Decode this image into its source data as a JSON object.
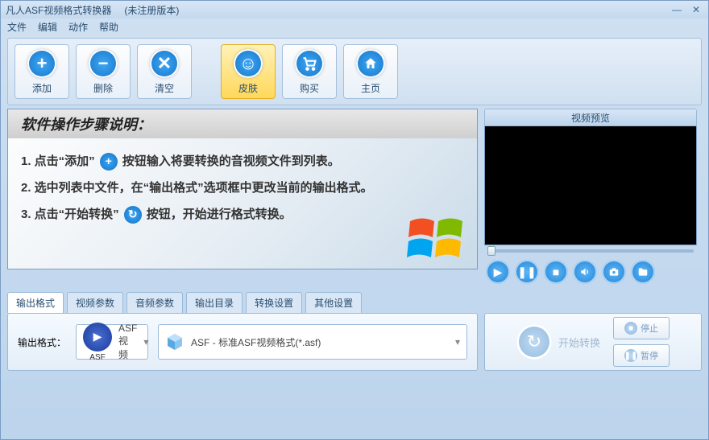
{
  "title": "凡人ASF视频格式转换器",
  "title_suffix": "(未注册版本)",
  "menus": [
    "文件",
    "编辑",
    "动作",
    "帮助"
  ],
  "toolbar": {
    "add": "添加",
    "remove": "删除",
    "clear": "清空",
    "skin": "皮肤",
    "buy": "购买",
    "home": "主页"
  },
  "instructions": {
    "title": "软件操作步骤说明：",
    "step1a": "1. 点击“添加”",
    "step1b": "按钮输入将要转换的音视频文件到列表。",
    "step2": "2. 选中列表中文件，在“输出格式”选项框中更改当前的输出格式。",
    "step3a": "3. 点击“开始转换”",
    "step3b": "按钮，开始进行格式转换。"
  },
  "preview": {
    "title": "视频预览"
  },
  "tabs": [
    "输出格式",
    "视频参数",
    "音频参数",
    "输出目录",
    "转换设置",
    "其他设置"
  ],
  "format": {
    "label": "输出格式：",
    "asf_label": "ASF",
    "asf_text": "ASF视频",
    "full_text": "ASF - 标准ASF视频格式(*.asf)"
  },
  "actions": {
    "start": "开始转换",
    "stop": "停止",
    "pause": "暂停"
  }
}
